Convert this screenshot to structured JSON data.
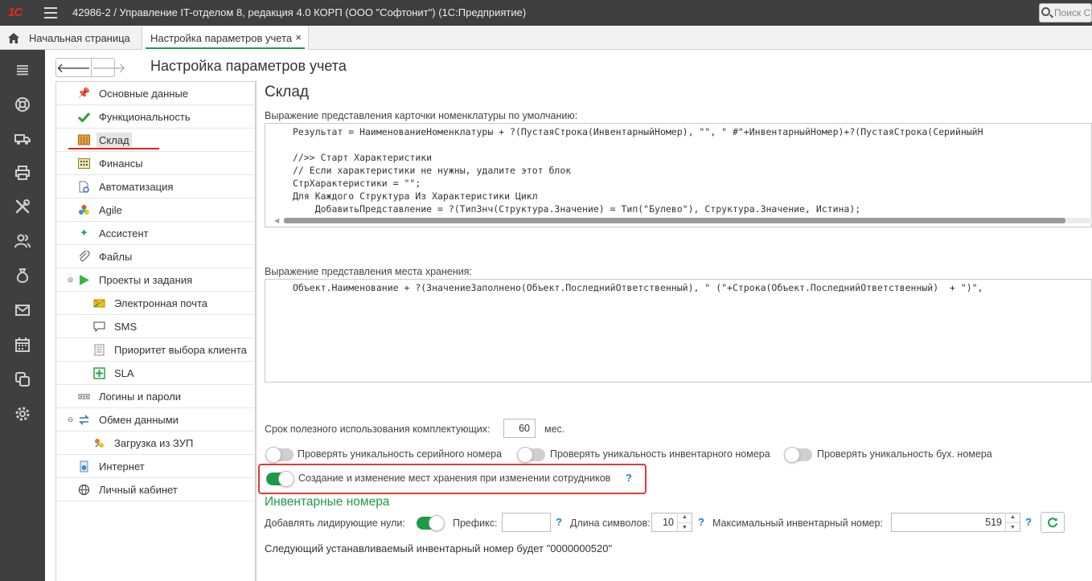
{
  "titlebar": {
    "logo": "1С",
    "title": "42986-2 / Управление IT-отделом 8, редакция 4.0 КОРП (ООО \"Софтонит\")  (1С:Предприятие)",
    "search_placeholder": "Поиск С"
  },
  "tabs": [
    {
      "label": "Начальная страница"
    },
    {
      "label": "Настройка параметров учета",
      "close": "×"
    }
  ],
  "header": {
    "back": "🡐",
    "forward": "🡒",
    "title": "Настройка параметров учета"
  },
  "nav": {
    "items": [
      {
        "label": "Основные данные",
        "icon": "pin-icon"
      },
      {
        "label": "Функциональность",
        "icon": "check-icon"
      },
      {
        "label": "Склад",
        "icon": "warehouse-icon"
      },
      {
        "label": "Финансы",
        "icon": "calculator-icon"
      },
      {
        "label": "Автоматизация",
        "icon": "document-gear-icon"
      },
      {
        "label": "Agile",
        "icon": "agile-icon"
      },
      {
        "label": "Ассистент",
        "icon": "sparkle-icon"
      },
      {
        "label": "Файлы",
        "icon": "paperclip-icon"
      },
      {
        "label": "Проекты и задания",
        "icon": "play-icon"
      },
      {
        "label": "Электронная почта",
        "icon": "email-icon"
      },
      {
        "label": "SMS",
        "icon": "chat-icon"
      },
      {
        "label": "Приоритет выбора клиента",
        "icon": "list-icon"
      },
      {
        "label": "SLA",
        "icon": "sla-icon"
      },
      {
        "label": "Логины и пароли",
        "icon": "password-icon"
      },
      {
        "label": "Обмен данными",
        "icon": "exchange-icon"
      },
      {
        "label": "Загрузка из ЗУП",
        "icon": "import-icon"
      },
      {
        "label": "Интернет",
        "icon": "internet-icon"
      },
      {
        "label": "Личный кабинет",
        "icon": "globe-icon"
      }
    ]
  },
  "content": {
    "section_title": "Склад",
    "card_expr_label": "Выражение представления карточки номенклатуры по умолчанию:",
    "card_expr_lines": [
      "Результат = НаименованиеНоменклатуры + ?(ПустаяСтрока(ИнвентарныйНомер), \"\", \" #\"+ИнвентарныйНомер)+?(ПустаяСтрока(СерийныйН",
      "",
      "//>> Старт Характеристики",
      "// Если характеристики не нужны, удалите этот блок",
      "СтрХарактеристики = \"\";",
      "Для Каждого Структура Из Характеристики Цикл",
      "    ДобавитьПредставление = ?(ТипЗнч(Структура.Значение) = Тип(\"Булево\"), Структура.Значение, Истина);"
    ],
    "storage_expr_label": "Выражение представления места хранения:",
    "storage_expr_lines": [
      "Объект.Наименование + ?(ЗначениеЗаполнено(Объект.ПоследнийОтветственный), \" (\"+Строка(Объект.ПоследнийОтветственный)  + \")\","
    ],
    "lifetime_label": "Срок полезного использования комплектующих:",
    "lifetime_value": "60",
    "lifetime_unit": "мес.",
    "toggles": [
      {
        "label": "Проверять уникальность серийного номера",
        "on": false
      },
      {
        "label": "Проверять уникальность инвентарного номера",
        "on": false
      },
      {
        "label": "Проверять уникальность бух. номера",
        "on": false
      }
    ],
    "storage_toggle": {
      "label": "Создание и изменение мест хранения при изменении сотрудников",
      "on": true,
      "help": "?"
    },
    "inventory": {
      "title": "Инвентарные номера",
      "leading_zeros_label": "Добавлять лидирующие нули:",
      "prefix_label": "Префикс:",
      "prefix_value": "",
      "length_label": "Длина символов:",
      "length_value": "10",
      "max_label": "Максимальный инвентарный номер:",
      "max_value": "519",
      "help": "?",
      "next_text": "Следующий устанавливаемый инвентарный номер будет \"0000000520\""
    }
  },
  "colors": {
    "accent_green": "#1d9a48",
    "highlight_red": "#e23b36",
    "titlebar": "#3f3f3f",
    "help_blue": "#1e7fc9"
  }
}
